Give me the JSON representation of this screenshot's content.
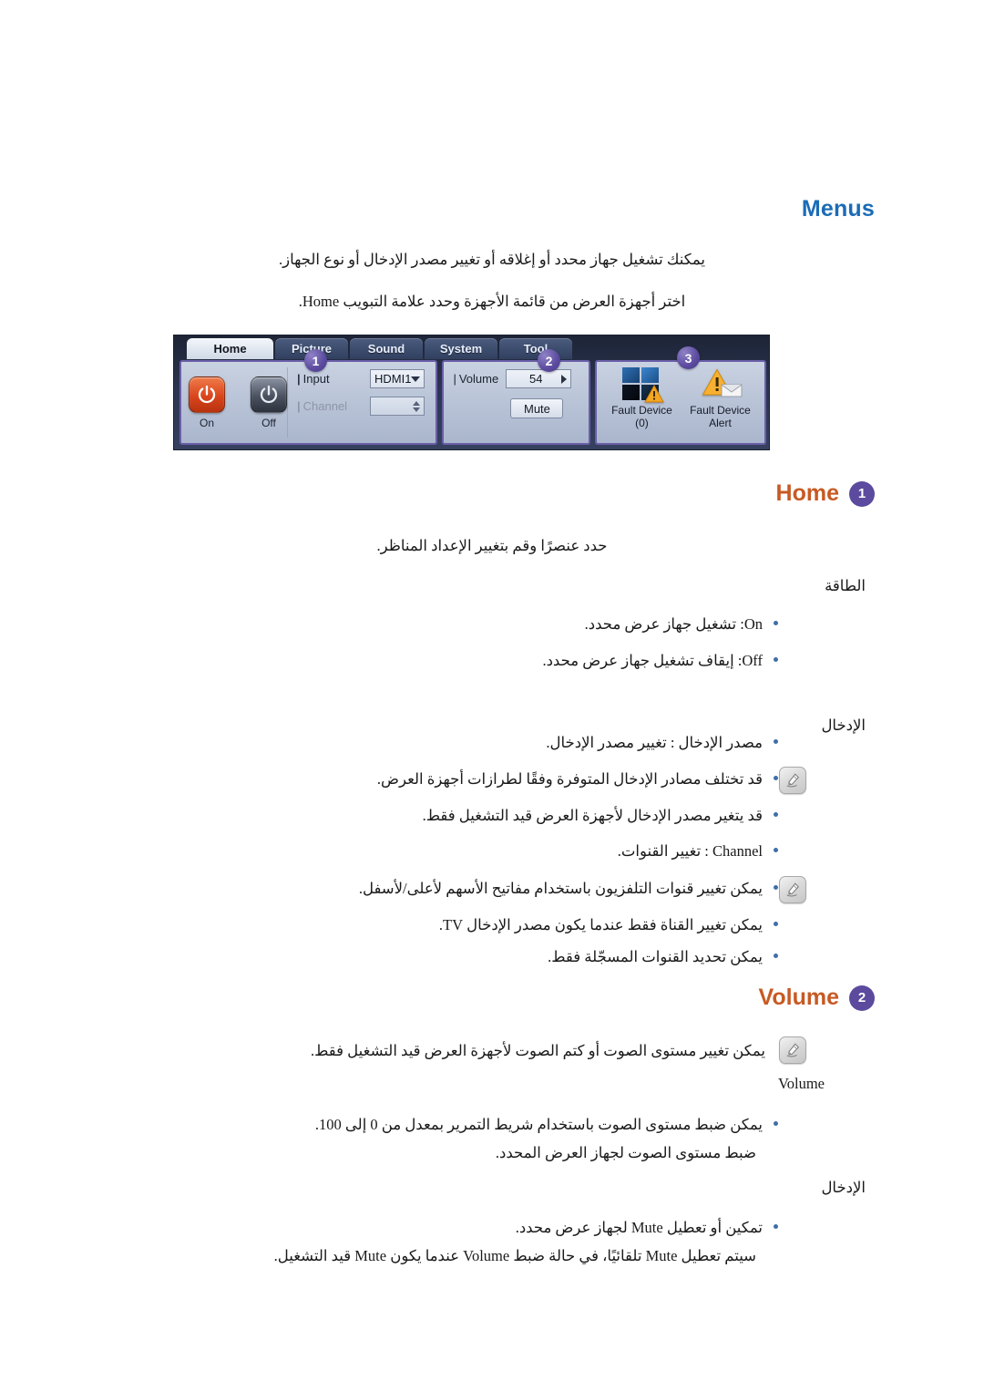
{
  "document": {
    "title": "Menus",
    "intro_lines": [
      "يمكنك تشغيل جهاز محدد أو إغلاقه أو تغيير مصدر الإدخال أو نوع الجهاز.",
      "اختر أجهزة العرض من قائمة الأجهزة وحدد علامة التبويب Home."
    ]
  },
  "osd": {
    "tabs": [
      {
        "label": "Home",
        "active": true
      },
      {
        "label": "Picture",
        "active": false
      },
      {
        "label": "Sound",
        "active": false
      },
      {
        "label": "System",
        "active": false
      },
      {
        "label": "Tool",
        "active": false
      }
    ],
    "power": {
      "on_label": "On",
      "off_label": "Off",
      "on_icon": "power-icon",
      "off_icon": "power-icon"
    },
    "io": {
      "input_label": "Input",
      "input_value": "HDMI1",
      "channel_label": "Channel",
      "channel_value": ""
    },
    "volume": {
      "label": "Volume",
      "value": "54",
      "mute_label": "Mute"
    },
    "fault": {
      "device_label_line1": "Fault Device",
      "device_label_line2": "(0)",
      "alert_label_line1": "Fault Device",
      "alert_label_line2": "Alert"
    },
    "badges": [
      "1",
      "2",
      "3"
    ]
  },
  "sections": [
    {
      "id": "home",
      "title": "Home",
      "badge": "1",
      "lead": "حدد عنصرًا وقم بتغيير الإعداد المناظر.",
      "groups": [
        {
          "subhead": "الطاقة",
          "bullets": [
            "On: تشغيل جهاز عرض محدد.",
            "Off: إيقاف تشغيل جهاز عرض محدد."
          ]
        },
        {
          "subhead": "الإدخال",
          "bullets": [
            "مصدر الإدخال : تغيير مصدر الإدخال.",
            "قد تختلف مصادر الإدخال المتوفرة وفقًا لطرازات أجهزة العرض.",
            "قد يتغير مصدر الإدخال لأجهزة العرض قيد التشغيل فقط.",
            "Channel : تغيير القنوات.",
            "يمكن تغيير قنوات التلفزيون باستخدام مفاتيح الأسهم لأعلى/لأسفل.",
            "يمكن تغيير القناة فقط عندما يكون مصدر الإدخال TV.",
            "يمكن تحديد القنوات المسجّلة فقط."
          ]
        }
      ]
    },
    {
      "id": "volume",
      "title": "Volume",
      "badge": "2",
      "note": "يمكن تغيير مستوى الصوت أو كتم الصوت لأجهزة العرض قيد التشغيل فقط.",
      "subhead_volume": "Volume",
      "bullets_volume": [
        "يمكن ضبط مستوى الصوت باستخدام شريط التمرير بمعدل من 0 إلى 100.",
        "ضبط مستوى الصوت لجهاز العرض المحدد."
      ],
      "subhead_input": "الإدخال",
      "bullets_input": [
        "تمكين أو تعطيل Mute لجهاز عرض محدد.",
        "سيتم تعطيل Mute تلقائيًا، في حالة ضبط Volume عندما يكون Mute قيد التشغيل."
      ]
    }
  ],
  "icons": {
    "note": "note-icon",
    "warning": "warning-triangle-icon",
    "display_grid": "display-grid-icon",
    "envelope": "envelope-icon"
  },
  "colors": {
    "title_blue": "#1b6cb5",
    "section_orange": "#c75a23",
    "badge_purple": "#5b4a9e",
    "bullet_blue": "#3f6fa8"
  }
}
